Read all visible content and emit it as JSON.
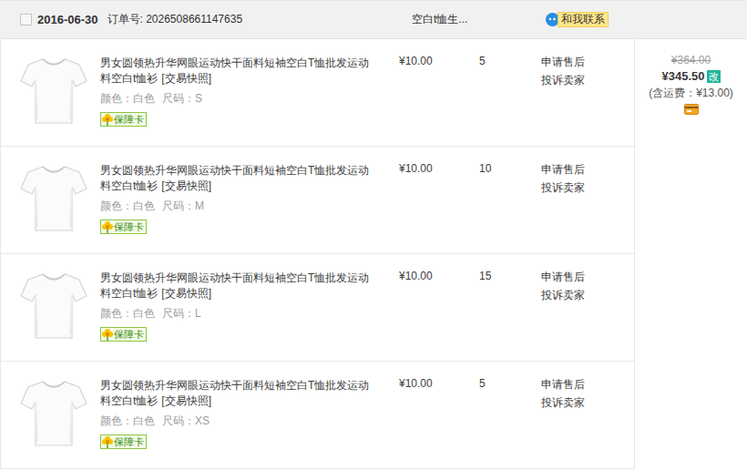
{
  "order": {
    "checked": false,
    "date": "2016-06-30",
    "order_no": "订单号: 2026508661147635",
    "shop": "空白t恤生...",
    "contact": "和我联系"
  },
  "items": [
    {
      "title": "男女圆领热升华网眼运动快干面料短袖空白T恤批发运动料空白t恤衫",
      "snapshot": "[交易快照]",
      "color": "颜色：白色",
      "size": "尺码：S",
      "badge": "保障卡",
      "price": "¥10.00",
      "qty": "5",
      "actions": [
        "申请售后",
        "投诉卖家"
      ]
    },
    {
      "title": "男女圆领热升华网眼运动快干面料短袖空白T恤批发运动料空白t恤衫",
      "snapshot": "[交易快照]",
      "color": "颜色：白色",
      "size": "尺码：M",
      "badge": "保障卡",
      "price": "¥10.00",
      "qty": "10",
      "actions": [
        "申请售后",
        "投诉卖家"
      ]
    },
    {
      "title": "男女圆领热升华网眼运动快干面料短袖空白T恤批发运动料空白t恤衫",
      "snapshot": "[交易快照]",
      "color": "颜色：白色",
      "size": "尺码：L",
      "badge": "保障卡",
      "price": "¥10.00",
      "qty": "15",
      "actions": [
        "申请售后",
        "投诉卖家"
      ]
    },
    {
      "title": "男女圆领热升华网眼运动快干面料短袖空白T恤批发运动料空白t恤衫",
      "snapshot": "[交易快照]",
      "color": "颜色：白色",
      "size": "尺码：XS",
      "badge": "保障卡",
      "price": "¥10.00",
      "qty": "5",
      "actions": [
        "申请售后",
        "投诉卖家"
      ]
    }
  ],
  "summary": {
    "original": "¥364.00",
    "total": "¥345.50",
    "edit_badge": "改",
    "shipping": "(含运费：¥13.00)"
  }
}
